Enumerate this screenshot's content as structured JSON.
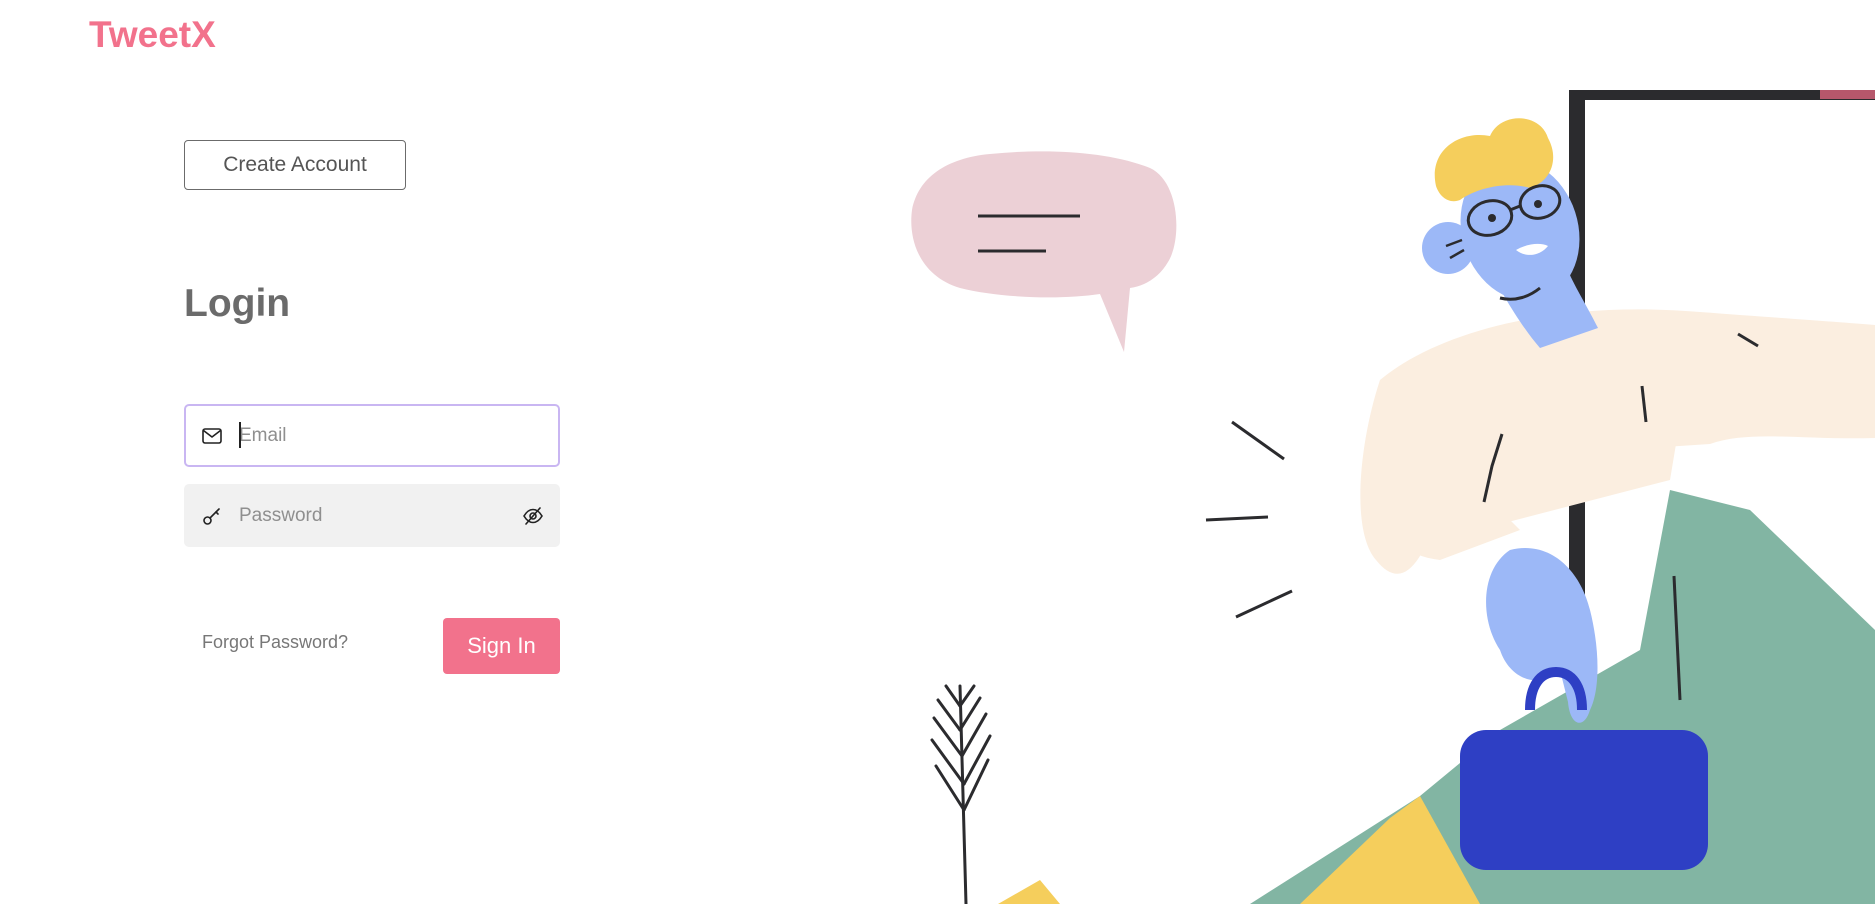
{
  "brand": {
    "name": "TweetX"
  },
  "header": {
    "create_account_label": "Create Account"
  },
  "login": {
    "title": "Login",
    "email": {
      "placeholder": "Email",
      "value": ""
    },
    "password": {
      "placeholder": "Password",
      "value": ""
    },
    "forgot_password_label": "Forgot Password?",
    "sign_in_label": "Sign In"
  },
  "icons": {
    "email": "mail-icon",
    "password": "key-icon",
    "toggle_visibility": "eye-off-icon"
  },
  "colors": {
    "accent": "#f2728c",
    "focus_border": "#c9b6f2",
    "input_bg": "#f1f1f1",
    "text_muted": "#6b6b6b"
  }
}
